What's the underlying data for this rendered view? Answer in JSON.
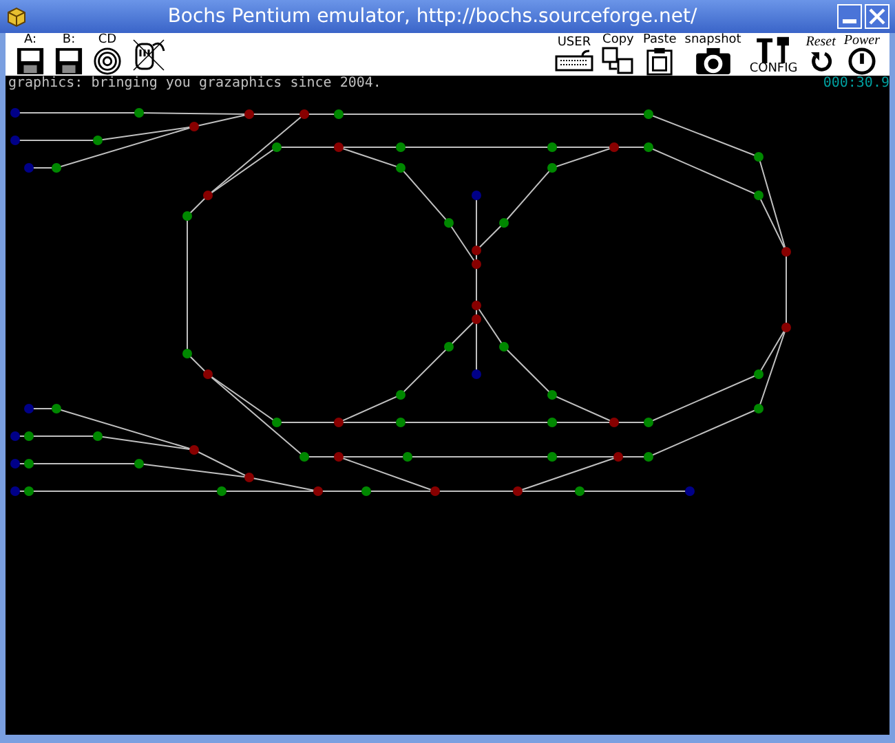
{
  "window": {
    "title": "Bochs Pentium emulator, http://bochs.sourceforge.net/"
  },
  "toolbar": {
    "left_buttons": [
      {
        "kind": "floppy",
        "label": "A:"
      },
      {
        "kind": "floppy",
        "label": "B:"
      },
      {
        "kind": "cdrom",
        "label": "CD"
      },
      {
        "kind": "mouse"
      }
    ],
    "right_buttons": [
      {
        "kind": "keyboard",
        "label": "USER"
      },
      {
        "kind": "copy",
        "label": "Copy"
      },
      {
        "kind": "paste",
        "label": "Paste"
      },
      {
        "kind": "snapshot",
        "label": "snapshot"
      },
      {
        "kind": "config",
        "label": "CONFIG"
      },
      {
        "kind": "reset",
        "label": "Reset"
      },
      {
        "kind": "power",
        "label": "Power"
      }
    ]
  },
  "screen": {
    "message": "graphics: bringing you grazaphics since 2004.",
    "timer": "000:30.9"
  }
}
